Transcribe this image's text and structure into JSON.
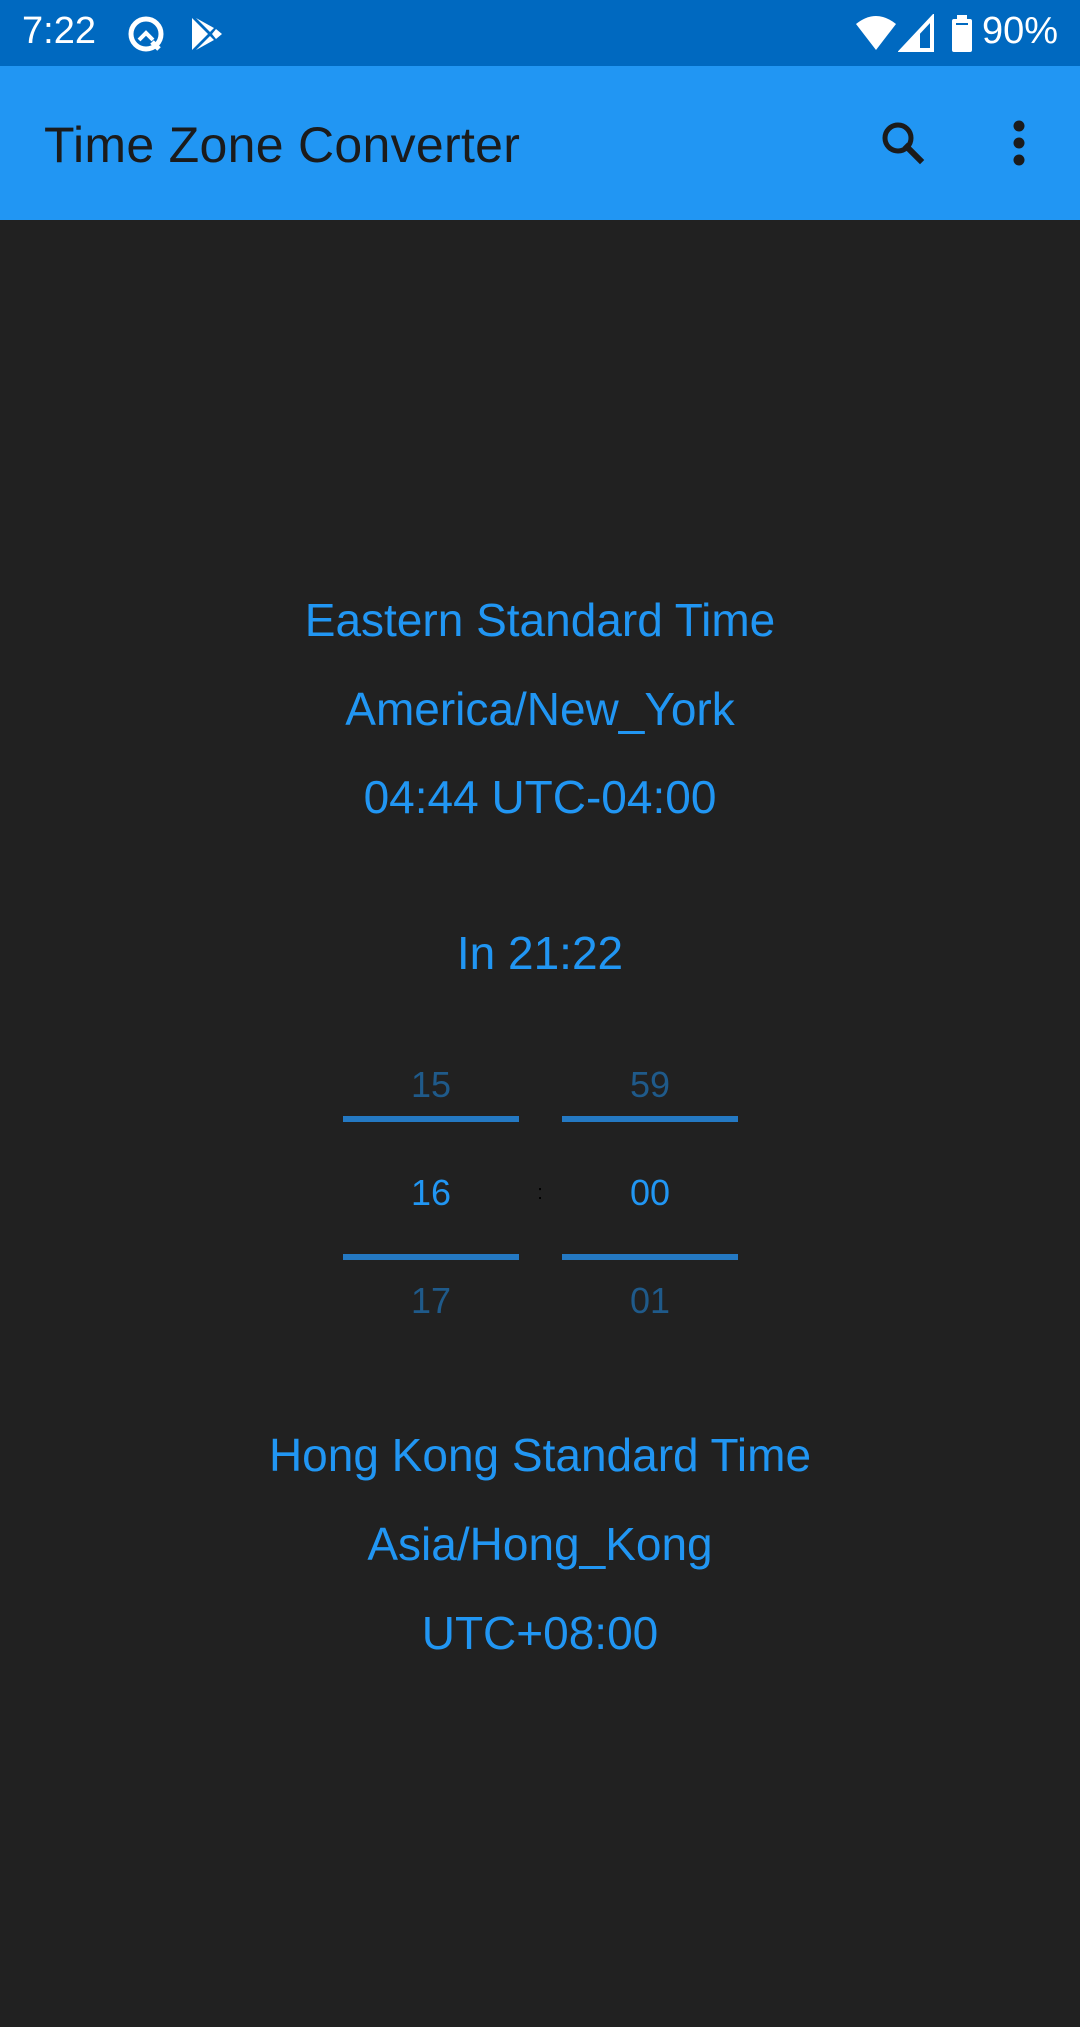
{
  "status_bar": {
    "time": "7:22",
    "left_icons": [
      "android-q-icon",
      "play-store-icon"
    ],
    "right_icons": [
      "wifi-icon",
      "cell-signal-icon",
      "battery-icon"
    ],
    "battery_percent": "90%"
  },
  "app_bar": {
    "title": "Time Zone Converter",
    "actions": [
      "search-icon",
      "more-vert-icon"
    ],
    "background_color": "#2196F3"
  },
  "source_zone": {
    "name": "Eastern Standard Time",
    "id": "America/New_York",
    "time_and_offset": "04:44 UTC-04:00"
  },
  "countdown": {
    "label": "In 21:22"
  },
  "time_picker": {
    "hour": {
      "previous": "15",
      "selected": "16",
      "next": "17"
    },
    "separator": ":",
    "minute": {
      "previous": "59",
      "selected": "00",
      "next": "01"
    }
  },
  "target_zone": {
    "name": "Hong Kong Standard Time",
    "id": "Asia/Hong_Kong",
    "offset": "UTC+08:00"
  },
  "colors": {
    "status_bar": "#0069C0",
    "accent": "#2196F3",
    "background": "#212121",
    "picker_faded": "#1F5A8A"
  }
}
